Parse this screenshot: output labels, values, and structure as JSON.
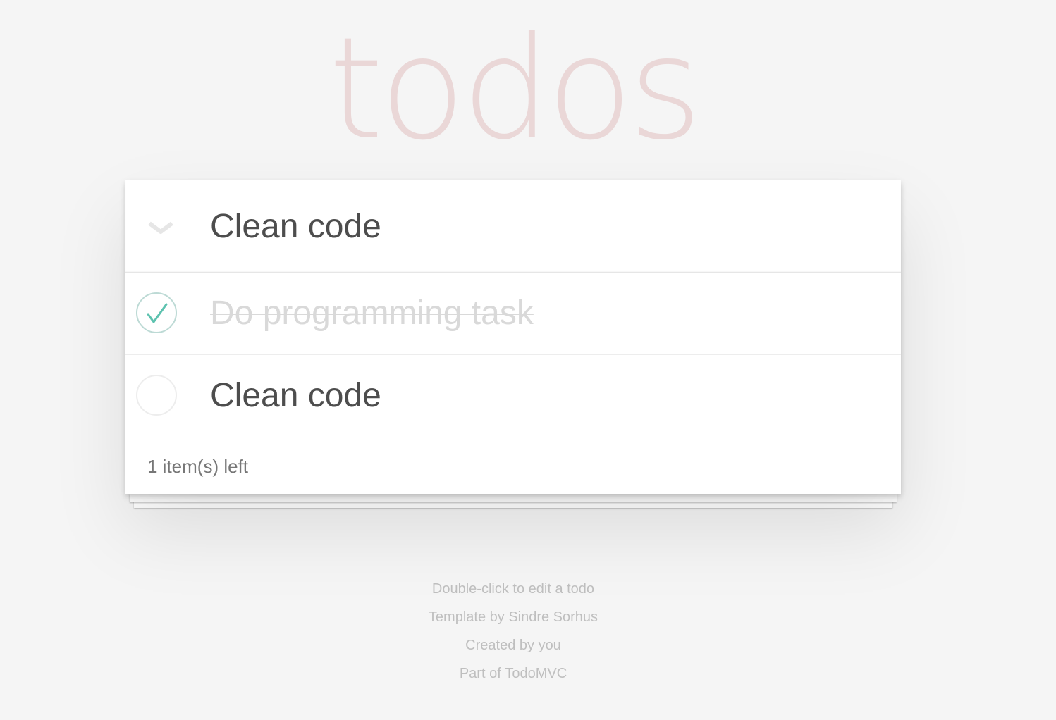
{
  "header": {
    "title": "todos",
    "new_todo_value": "Clean code",
    "toggle_all_icon": "chevron-down-icon"
  },
  "todos": [
    {
      "title": "Do programming task",
      "completed": true
    },
    {
      "title": "Clean code",
      "completed": false
    }
  ],
  "footer": {
    "count_text": "1 item(s) left"
  },
  "info": {
    "hint": "Double-click to edit a todo",
    "template_prefix": "Template by ",
    "template_link": "Sindre Sorhus",
    "created_prefix": "Created by ",
    "created_link": "you",
    "part_prefix": "Part of ",
    "part_link": "TodoMVC"
  },
  "colors": {
    "background": "#f5f5f5",
    "title": "#efd6d6",
    "check_accent": "#5dc2af",
    "completed_text": "#d9d9d9"
  }
}
